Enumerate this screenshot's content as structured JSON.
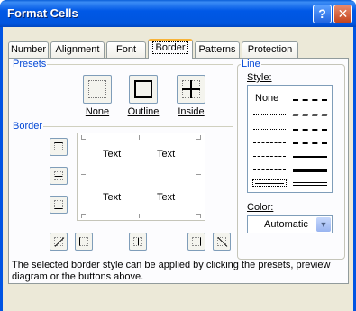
{
  "window": {
    "title": "Format Cells",
    "help_icon": "?",
    "close_icon": "✕"
  },
  "tabs": [
    {
      "label": "Number"
    },
    {
      "label": "Alignment"
    },
    {
      "label": "Font"
    },
    {
      "label": "Border",
      "active": true
    },
    {
      "label": "Patterns"
    },
    {
      "label": "Protection"
    }
  ],
  "presets": {
    "group_label": "Presets",
    "none_label": "None",
    "outline_label": "Outline",
    "inside_label": "Inside"
  },
  "border": {
    "group_label": "Border",
    "preview_text": [
      "Text",
      "Text",
      "Text",
      "Text"
    ]
  },
  "line": {
    "group_label": "Line",
    "style_label": "Style:",
    "none_option": "None",
    "color_label": "Color:",
    "color_value": "Automatic"
  },
  "note": "The selected border style can be applied by clicking the presets, preview diagram or the buttons above."
}
